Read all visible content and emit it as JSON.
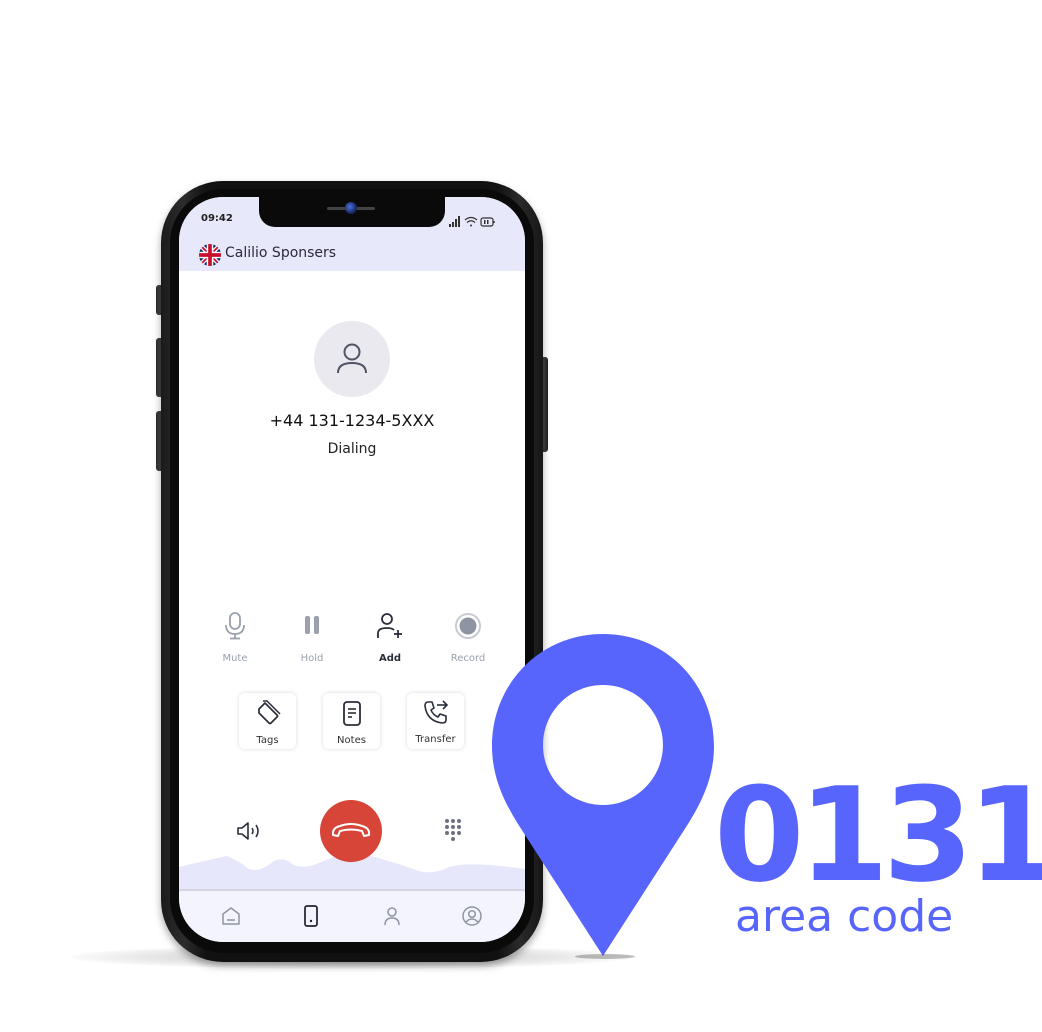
{
  "status_bar": {
    "time": "09:42",
    "icons": [
      "signal-icon",
      "wifi-icon",
      "battery-icon"
    ]
  },
  "header": {
    "flag": "uk-flag-icon",
    "title": "Calilio Sponsers"
  },
  "call": {
    "avatar_icon": "user-icon",
    "phone_number": "+44 131-1234-5XXX",
    "status": "Dialing"
  },
  "controls": [
    {
      "label": "Mute",
      "icon": "microphone-icon",
      "state": "disabled"
    },
    {
      "label": "Hold",
      "icon": "pause-icon",
      "state": "disabled"
    },
    {
      "label": "Add",
      "icon": "add-user-icon",
      "state": "active"
    },
    {
      "label": "Record",
      "icon": "record-icon",
      "state": "disabled"
    }
  ],
  "actions": [
    {
      "label": "Tags",
      "icon": "tag-icon"
    },
    {
      "label": "Notes",
      "icon": "notes-icon"
    },
    {
      "label": "Transfer",
      "icon": "call-transfer-icon"
    }
  ],
  "bottom_controls": {
    "speaker_icon": "speaker-icon",
    "end_call_icon": "hang-up-icon",
    "keypad_icon": "keypad-icon"
  },
  "tabbar": [
    {
      "name": "home",
      "icon": "home-icon",
      "active": false
    },
    {
      "name": "phone",
      "icon": "phone-device-icon",
      "active": true
    },
    {
      "name": "contacts",
      "icon": "contact-icon",
      "active": false
    },
    {
      "name": "profile",
      "icon": "profile-icon",
      "active": false
    }
  ],
  "promo": {
    "code": "0131",
    "subtitle": "area code",
    "pin_icon": "location-pin-icon"
  },
  "colors": {
    "brand_blue": "#5865fc",
    "end_call_red": "#d64538",
    "header_bg": "#e8e8fb"
  }
}
